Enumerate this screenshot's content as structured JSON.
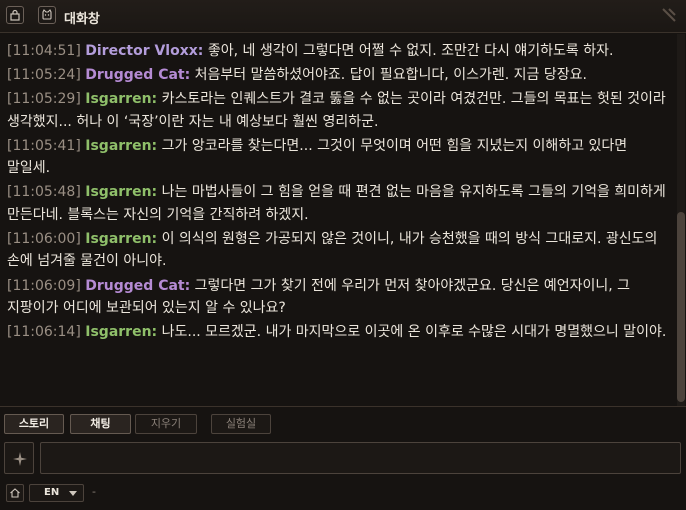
{
  "window": {
    "title": "대화창"
  },
  "colors": {
    "timestamp": "#9a8f84",
    "director": "#b39ddb",
    "drugged_cat": "#b58bd4",
    "isgarren": "#8fbf6a"
  },
  "messages": [
    {
      "time": "[11:04:51]",
      "speaker": "Director Vloxx:",
      "speaker_color": "#b39ddb",
      "text": " 좋아, 네 생각이 그렇다면 어쩔 수 없지. 조만간 다시 얘기하도록 하자."
    },
    {
      "time": "[11:05:24]",
      "speaker": "Drugged Cat:",
      "speaker_color": "#b58bd4",
      "text": " 처음부터 말씀하셨어야죠. 답이 필요합니다, 이스가렌. 지금 당장요."
    },
    {
      "time": "[11:05:29]",
      "speaker": "Isgarren:",
      "speaker_color": "#8fbf6a",
      "text": " 카스토라는 인퀘스트가 결코 뚫을 수 없는 곳이라 여겼건만. 그들의 목표는 헛된 것이라 생각했지... 허나 이 ‘국장’이란 자는 내 예상보다 훨씬 영리하군."
    },
    {
      "time": "[11:05:41]",
      "speaker": "Isgarren:",
      "speaker_color": "#8fbf6a",
      "text": " 그가 앙코라를 찾는다면... 그것이 무엇이며 어떤 힘을 지녔는지 이해하고 있다면 말일세."
    },
    {
      "time": "[11:05:48]",
      "speaker": "Isgarren:",
      "speaker_color": "#8fbf6a",
      "text": " 나는 마법사들이 그 힘을 얻을 때 편견 없는 마음을 유지하도록 그들의 기억을 희미하게 만든다네. 블록스는 자신의 기억을 간직하려 하겠지."
    },
    {
      "time": "[11:06:00]",
      "speaker": "Isgarren:",
      "speaker_color": "#8fbf6a",
      "text": " 이 의식의 원형은 가공되지 않은 것이니, 내가 승천했을 때의 방식 그대로지. 광신도의 손에 넘겨줄 물건이 아니야."
    },
    {
      "time": "[11:06:09]",
      "speaker": "Drugged Cat:",
      "speaker_color": "#b58bd4",
      "text": " 그렇다면 그가 찾기 전에 우리가 먼저 찾아야겠군요. 당신은 예언자이니, 그 지팡이가 어디에 보관되어 있는지 알 수 있나요?"
    },
    {
      "time": "[11:06:14]",
      "speaker": "Isgarren:",
      "speaker_color": "#8fbf6a",
      "text": " 나도... 모르겠군. 내가 마지막으로 이곳에 온 이후로 수많은 시대가 명멸했으니 말이야."
    }
  ],
  "tabs": [
    {
      "label": "스토리",
      "state": "active"
    },
    {
      "label": "채팅",
      "state": "active"
    },
    {
      "label": "지우기",
      "state": "dim"
    },
    {
      "label": "실험실",
      "state": "dim"
    }
  ],
  "input": {
    "value": "",
    "placeholder": ""
  },
  "footer": {
    "language": "EN",
    "status": "-"
  },
  "icons": {
    "lock": "lock-icon",
    "cat": "cat-icon",
    "sparkle": "sparkle-icon",
    "home": "home-icon"
  }
}
